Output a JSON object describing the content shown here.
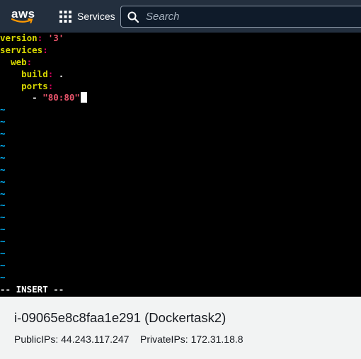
{
  "topbar": {
    "logo_text": "aws",
    "services_label": "Services",
    "search_placeholder": "Search"
  },
  "terminal": {
    "lines": [
      {
        "key": "version",
        "sep": ":",
        "value": " '3'"
      },
      {
        "key": "services",
        "sep": ":"
      },
      {
        "indent": "  ",
        "key": "web",
        "sep": ":"
      },
      {
        "indent": "    ",
        "key": "build",
        "sep": ":",
        "value": " ."
      },
      {
        "indent": "    ",
        "key": "ports",
        "sep": ":"
      },
      {
        "indent": "      ",
        "dash": "- ",
        "value": "\"80:80\""
      }
    ],
    "tilde": "~",
    "status": "-- INSERT --"
  },
  "instance": {
    "title": "i-09065e8c8faa1e291 (Dockertask2)",
    "public_label": "PublicIPs:",
    "public_ip": "44.243.117.247",
    "private_label": "PrivateIPs:",
    "private_ip": "172.31.18.8"
  },
  "colors": {
    "aws_bar": "#232f3e",
    "aws_orange": "#ff9900",
    "yaml_key": "#d7d700",
    "yaml_string": "#d7005f",
    "tilde": "#00b7ff"
  }
}
